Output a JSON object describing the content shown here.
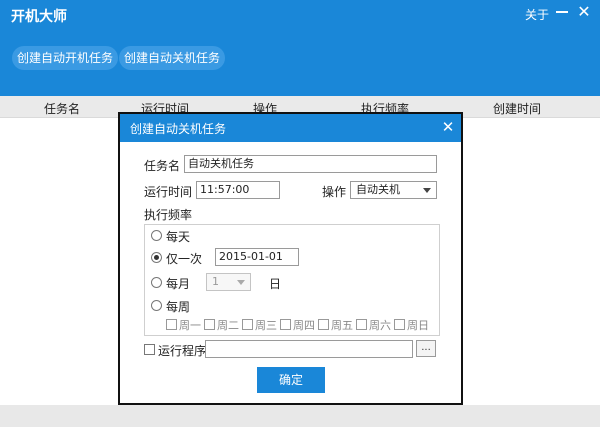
{
  "app": {
    "title": "开机大师",
    "about_label": "关于",
    "close_glyph": "✕"
  },
  "toolbar": {
    "create_startup_task_label": "创建自动开机任务",
    "create_shutdown_task_label": "创建自动关机任务"
  },
  "table": {
    "columns": [
      "任务名",
      "运行时间",
      "操作",
      "执行频率",
      "创建时间"
    ]
  },
  "dialog": {
    "title": "创建自动关机任务",
    "close_glyph": "✕",
    "task_name_label": "任务名",
    "task_name_value": "自动关机任务",
    "run_time_label": "运行时间",
    "run_time_value": "11:57:00",
    "operation_label": "操作",
    "operation_value": "自动关机",
    "frequency_label": "执行频率",
    "frequency_options": {
      "daily": "每天",
      "once": "仅一次",
      "monthly": "每月",
      "weekly": "每周"
    },
    "selected_frequency": "once",
    "once_date_value": "2015-01-01",
    "month_day_value": "1",
    "month_day_suffix": "日",
    "weekdays": [
      "周一",
      "周二",
      "周三",
      "周四",
      "周五",
      "周六",
      "周日"
    ],
    "run_program_label": "运行程序",
    "run_program_value": "",
    "browse_label": "...",
    "ok_label": "确定"
  }
}
